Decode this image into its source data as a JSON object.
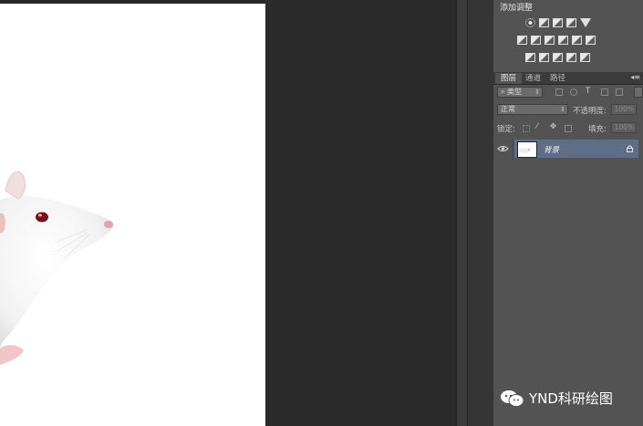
{
  "adjustments": {
    "title": "添加调整",
    "row1": [
      "brightness-icon",
      "levels-icon",
      "curves-icon",
      "exposure-icon",
      "vibrance-icon"
    ],
    "row2": [
      "hue-saturation-icon",
      "color-balance-icon",
      "black-white-icon",
      "photo-filter-icon",
      "channel-mixer-icon",
      "color-lookup-icon"
    ],
    "row3": [
      "invert-icon",
      "posterize-icon",
      "threshold-icon",
      "gradient-map-icon",
      "selective-color-icon"
    ]
  },
  "layers_panel": {
    "tabs": [
      "图层",
      "通道",
      "路径"
    ],
    "filter_kind": "类型",
    "blend_mode": "正常",
    "opacity_label": "不透明度:",
    "opacity_value": "100%",
    "lock_label": "锁定:",
    "fill_label": "填充:",
    "fill_value": "100%",
    "layer_name": "背景"
  },
  "watermark": {
    "text": "YND科研绘图"
  },
  "colors": {
    "panel": "#535353",
    "layer_selected": "#5f6e86",
    "workspace": "#282828"
  }
}
